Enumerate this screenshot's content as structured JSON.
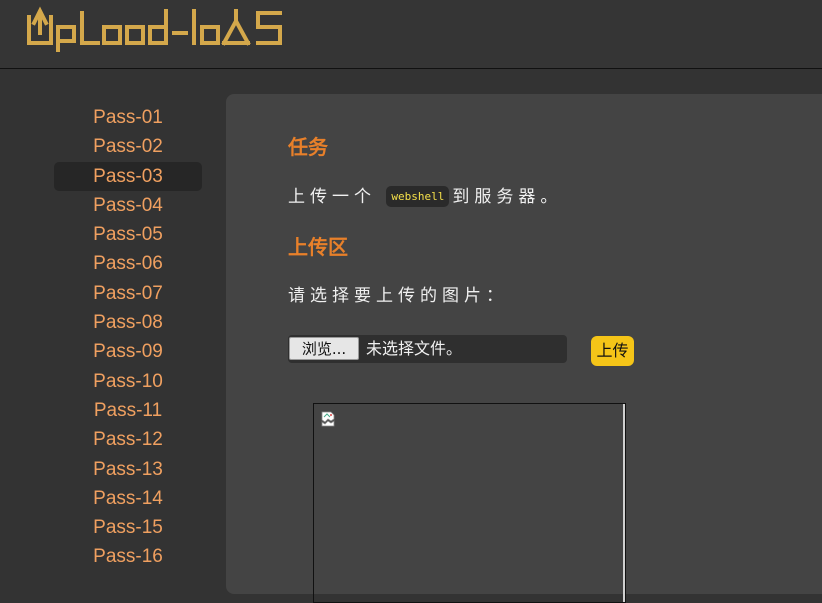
{
  "header": {
    "logo_text": "UpLoad-labs",
    "logo_icon": "upload-labs-logo",
    "colors": {
      "logo": "#d4a84b",
      "background": "#353535"
    }
  },
  "sidebar": {
    "active_index": 2,
    "items": [
      {
        "label": "Pass-01"
      },
      {
        "label": "Pass-02"
      },
      {
        "label": "Pass-03"
      },
      {
        "label": "Pass-04"
      },
      {
        "label": "Pass-05"
      },
      {
        "label": "Pass-06"
      },
      {
        "label": "Pass-07"
      },
      {
        "label": "Pass-08"
      },
      {
        "label": "Pass-09"
      },
      {
        "label": "Pass-10"
      },
      {
        "label": "Pass-11"
      },
      {
        "label": "Pass-12"
      },
      {
        "label": "Pass-13"
      },
      {
        "label": "Pass-14"
      },
      {
        "label": "Pass-15"
      },
      {
        "label": "Pass-16"
      }
    ],
    "colors": {
      "item_text": "#f0a060",
      "active_bg": "#262626"
    }
  },
  "main": {
    "task_heading": "任务",
    "task_text_before": "上传一个",
    "task_code": "webshell",
    "task_text_after": "到服务器。",
    "upload_heading": "上传区",
    "prompt": "请选择要上传的图片：",
    "file_input": {
      "browse_label": "浏览...",
      "status": "未选择文件。"
    },
    "submit_label": "上传",
    "preview_icon": "broken-image-icon",
    "colors": {
      "heading": "#e8802a",
      "code_text": "#f5e04a",
      "submit_bg": "#f5c518",
      "panel_bg": "#444444"
    }
  }
}
